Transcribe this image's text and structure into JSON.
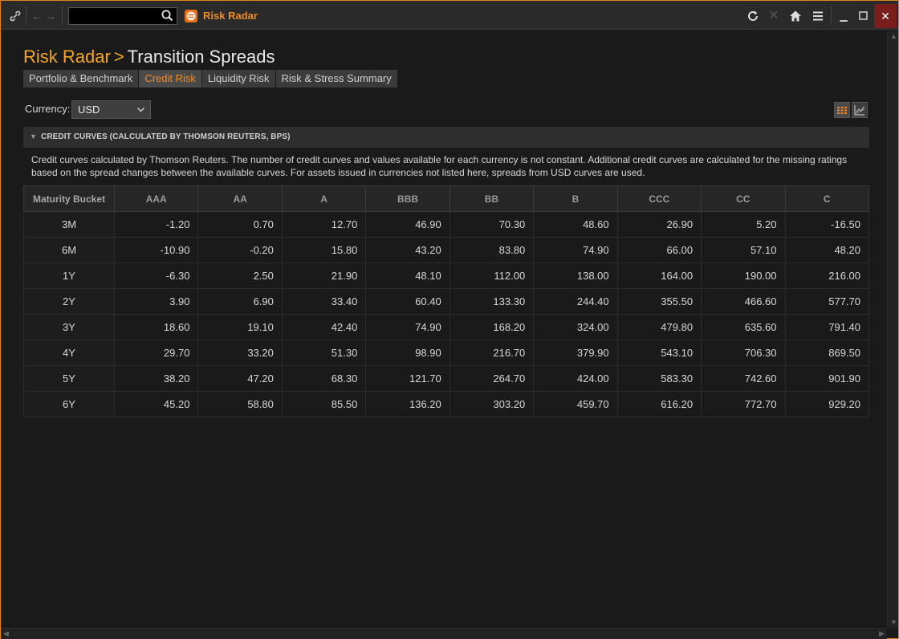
{
  "titlebar": {
    "app_name": "Risk Radar",
    "search_value": ""
  },
  "breadcrumb": {
    "app": "Risk Radar",
    "separator": ">",
    "page": "Transition Spreads"
  },
  "tabs": [
    {
      "label": "Portfolio & Benchmark",
      "active": false
    },
    {
      "label": "Credit Risk",
      "active": true
    },
    {
      "label": "Liquidity Risk",
      "active": false
    },
    {
      "label": "Risk & Stress Summary",
      "active": false
    }
  ],
  "currency": {
    "label": "Currency:",
    "selected": "USD"
  },
  "section": {
    "title": "CREDIT CURVES (CALCULATED BY THOMSON REUTERS, BPS)",
    "description": "Credit curves calculated by Thomson Reuters. The number of credit curves and values available for each currency is not constant. Additional credit curves are calculated for the missing ratings based on the spread changes between the available curves. For assets issued in currencies not listed here, spreads from USD curves are used."
  },
  "table": {
    "headers": [
      "Maturity Bucket",
      "AAA",
      "AA",
      "A",
      "BBB",
      "BB",
      "B",
      "CCC",
      "CC",
      "C"
    ],
    "rows": [
      [
        "3M",
        "-1.20",
        "0.70",
        "12.70",
        "46.90",
        "70.30",
        "48.60",
        "26.90",
        "5.20",
        "-16.50"
      ],
      [
        "6M",
        "-10.90",
        "-0.20",
        "15.80",
        "43.20",
        "83.80",
        "74.90",
        "66.00",
        "57.10",
        "48.20"
      ],
      [
        "1Y",
        "-6.30",
        "2.50",
        "21.90",
        "48.10",
        "112.00",
        "138.00",
        "164.00",
        "190.00",
        "216.00"
      ],
      [
        "2Y",
        "3.90",
        "6.90",
        "33.40",
        "60.40",
        "133.30",
        "244.40",
        "355.50",
        "466.60",
        "577.70"
      ],
      [
        "3Y",
        "18.60",
        "19.10",
        "42.40",
        "74.90",
        "168.20",
        "324.00",
        "479.80",
        "635.60",
        "791.40"
      ],
      [
        "4Y",
        "29.70",
        "33.20",
        "51.30",
        "98.90",
        "216.70",
        "379.90",
        "543.10",
        "706.30",
        "869.50"
      ],
      [
        "5Y",
        "38.20",
        "47.20",
        "68.30",
        "121.70",
        "264.70",
        "424.00",
        "583.30",
        "742.60",
        "901.90"
      ],
      [
        "6Y",
        "45.20",
        "58.80",
        "85.50",
        "136.20",
        "303.20",
        "459.70",
        "616.20",
        "772.70",
        "929.20"
      ]
    ]
  },
  "colors": {
    "accent": "#f08a24",
    "background": "#1a1a1a"
  }
}
